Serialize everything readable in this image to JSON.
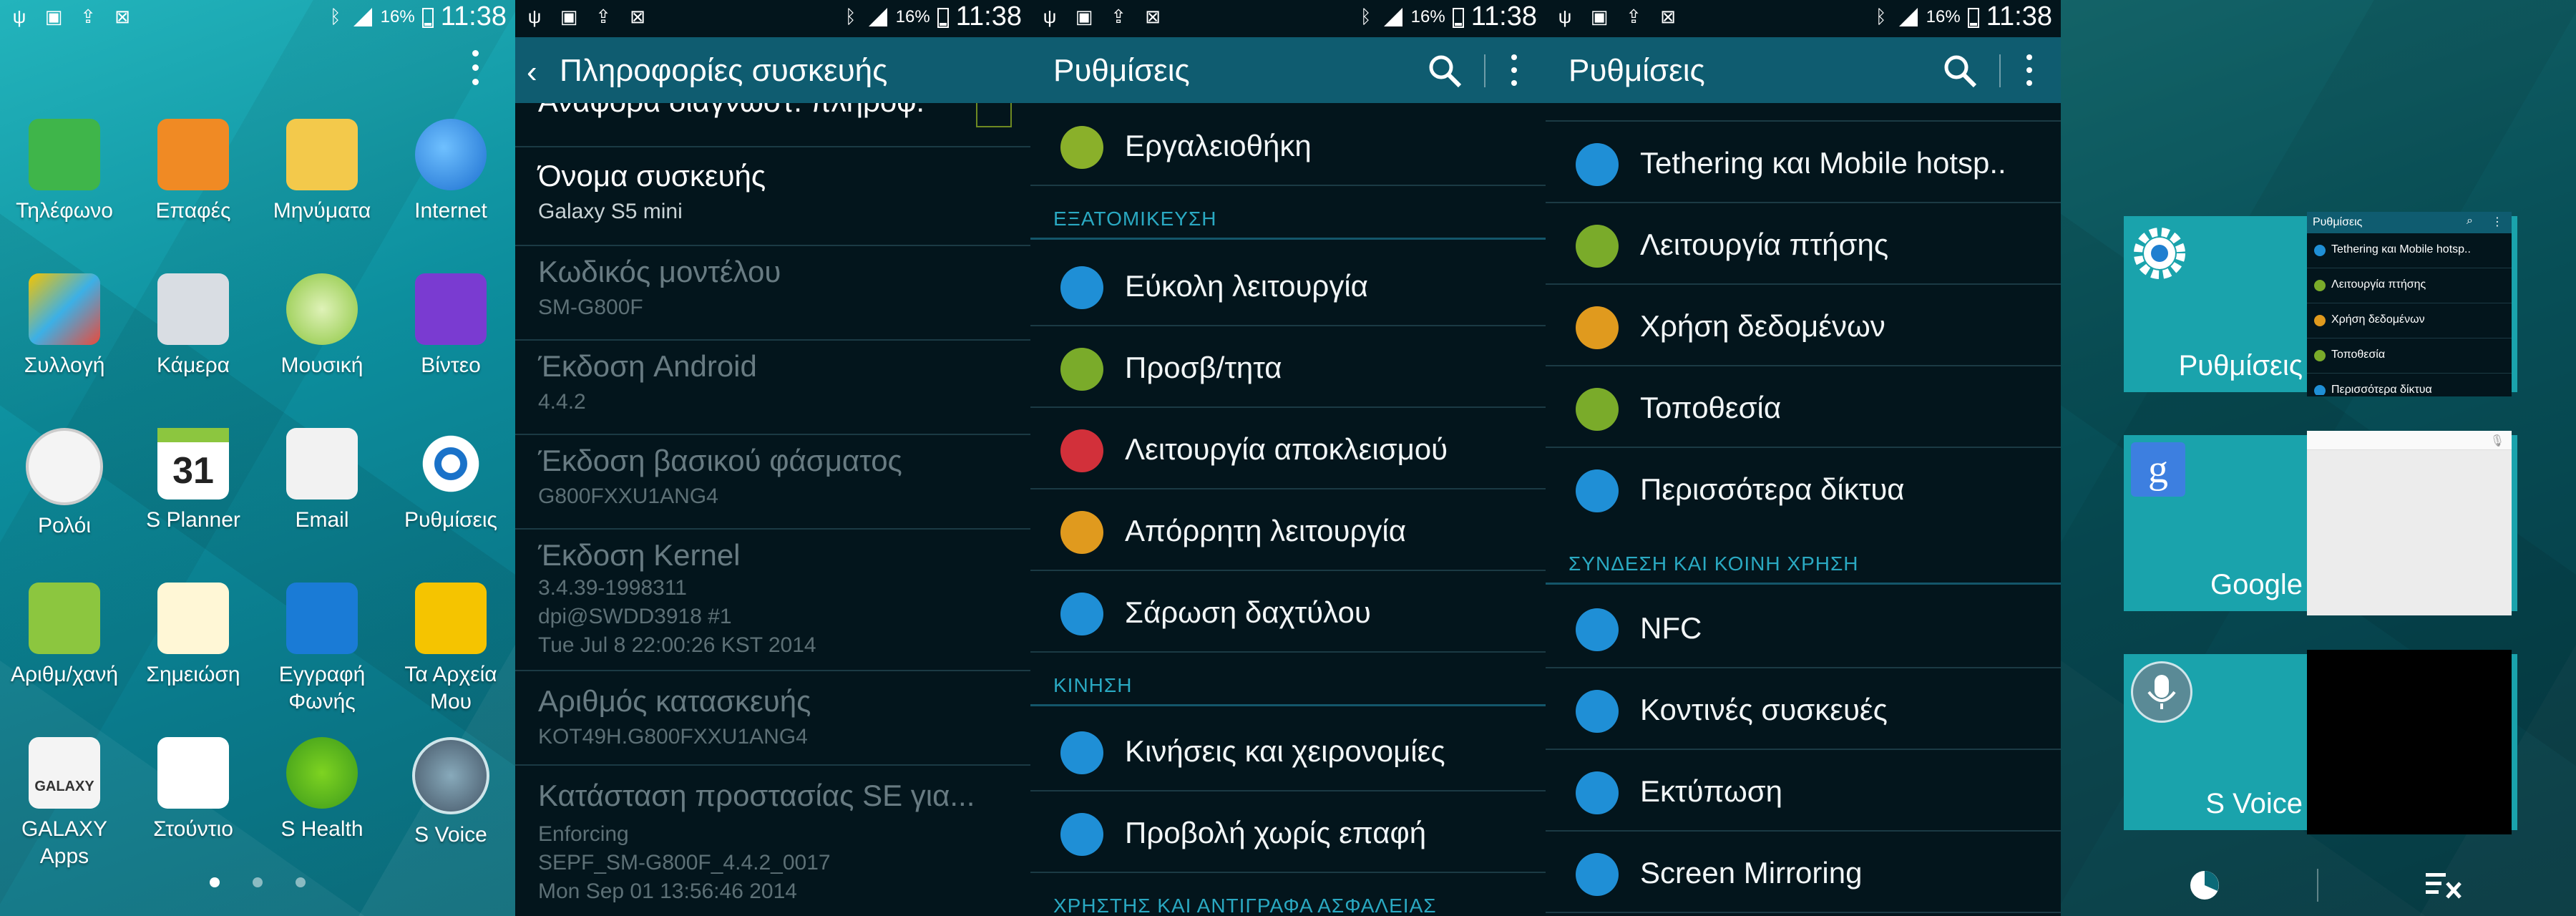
{
  "status": {
    "battery_pct": "16%",
    "time": "11:38"
  },
  "home": {
    "apps": [
      {
        "label": "Τηλέφωνο",
        "icon": "phone-icon"
      },
      {
        "label": "Επαφές",
        "icon": "contacts-icon"
      },
      {
        "label": "Μηνύματα",
        "icon": "messages-icon"
      },
      {
        "label": "Internet",
        "icon": "internet-globe-icon"
      },
      {
        "label": "Συλλογή",
        "icon": "gallery-icon"
      },
      {
        "label": "Κάμερα",
        "icon": "camera-icon"
      },
      {
        "label": "Μουσική",
        "icon": "music-icon"
      },
      {
        "label": "Βίντεο",
        "icon": "video-icon"
      },
      {
        "label": "Ρολόι",
        "icon": "clock-icon"
      },
      {
        "label": "S Planner",
        "icon": "calendar-icon",
        "date": "31"
      },
      {
        "label": "Email",
        "icon": "email-icon"
      },
      {
        "label": "Ρυθμίσεις",
        "icon": "settings-gear-icon"
      },
      {
        "label": "Αριθμ/χανή",
        "icon": "calculator-icon"
      },
      {
        "label": "Σημειώση",
        "icon": "memo-icon"
      },
      {
        "label": "Εγγραφή Φωνής",
        "icon": "voice-recorder-icon"
      },
      {
        "label": "Τα Αρχεία Μου",
        "icon": "folder-icon"
      },
      {
        "label": "GALAXY Apps",
        "icon": "galaxy-apps-icon",
        "badge": "GALAXY"
      },
      {
        "label": "Στούντιο",
        "icon": "studio-icon"
      },
      {
        "label": "S Health",
        "icon": "s-health-icon"
      },
      {
        "label": "S Voice",
        "icon": "s-voice-icon"
      }
    ],
    "page_count": 3,
    "active_page": 1
  },
  "device_info": {
    "title": "Πληροφορίες συσκευής",
    "partial_top": "Αναφορά διαγνωστ. πληροφ.",
    "items": [
      {
        "title": "Όνομα συσκευής",
        "value": "Galaxy S5 mini"
      },
      {
        "title": "Κωδικός μοντέλου",
        "value": "SM-G800F"
      },
      {
        "title": "Έκδοση Android",
        "value": "4.4.2"
      },
      {
        "title": "Έκδοση βασικού φάσματος",
        "value": "G800FXXU1ANG4"
      },
      {
        "title": "Έκδοση Kernel",
        "value": "3.4.39-1998311",
        "value2": "dpi@SWDD3918 #1",
        "value3": "Tue Jul 8 22:00:26 KST 2014"
      },
      {
        "title": "Αριθμός κατασκευής",
        "value": "KOT49H.G800FXXU1ANG4"
      },
      {
        "title": "Κατάσταση προστασίας SE για...",
        "value": "Enforcing",
        "value2": "SEPF_SM-G800F_4.4.2_0017",
        "value3": "Mon Sep 01 13:56:46 2014"
      }
    ]
  },
  "settings_a": {
    "title": "Ρυθμίσεις",
    "top_item": "Εργαλειοθήκη",
    "section_personal": "ΕΞΑΤΟΜΙΚΕΥΣΗ",
    "personal_items": [
      "Εύκολη λειτουργία",
      "Προσβ/τητα",
      "Λειτουργία αποκλεισμού",
      "Απόρρητη λειτουργία",
      "Σάρωση δαχτύλου"
    ],
    "section_motion": "ΚΙΝΗΣΗ",
    "motion_items": [
      "Κινήσεις και χειρονομίες",
      "Προβολή χωρίς επαφή"
    ],
    "section_backup": "ΧΡΗΣΤΗΣ ΚΑΙ ΑΝΤΙΓΡΑΦΑ ΑΣΦΑΛΕΙΑΣ"
  },
  "settings_b": {
    "title": "Ρυθμίσεις",
    "network_items": [
      "Tethering και Mobile hotsp..",
      "Λειτουργία πτήσης",
      "Χρήση δεδομένων",
      "Τοποθεσία",
      "Περισσότερα δίκτυα"
    ],
    "section_connect": "ΣΥΝΔΕΣΗ ΚΑΙ ΚΟΙΝΗ ΧΡΗΣΗ",
    "connect_items": [
      "NFC",
      "Κοντινές συσκευές",
      "Εκτύπωση",
      "Screen Mirroring"
    ]
  },
  "recents": {
    "cards": [
      {
        "title": "Ρυθμίσεις",
        "icon": "settings-gear-icon"
      },
      {
        "title": "Google",
        "icon": "google-icon"
      },
      {
        "title": "S Voice",
        "icon": "s-voice-icon"
      }
    ],
    "thumb_settings": {
      "title": "Ρυθμίσεις",
      "rows": [
        "Tethering και Mobile hotsp..",
        "Λειτουργία πτήσης",
        "Χρήση δεδομένων",
        "Τοποθεσία",
        "Περισσότερα δίκτυα"
      ]
    }
  },
  "colors": {
    "action_bar": "#0f5c70",
    "list_bg": "#03151c",
    "section_header": "#2aa9c2",
    "recents_card": "#1aa3ac"
  }
}
